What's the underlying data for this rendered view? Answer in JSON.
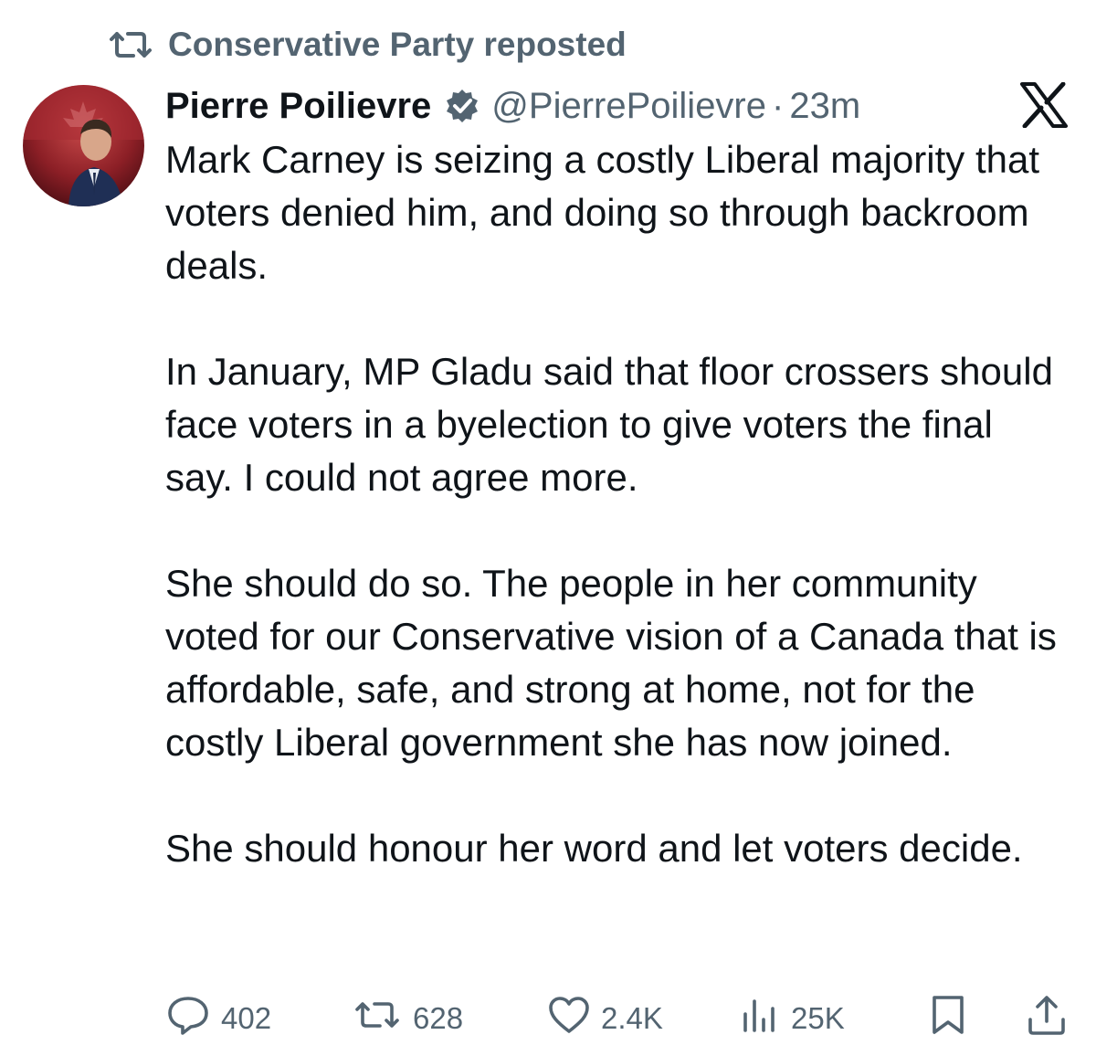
{
  "repost": {
    "icon": "repost-icon",
    "label": "Conservative Party reposted"
  },
  "author": {
    "name": "Pierre Poilievre",
    "verified_icon": "verified-badge-icon",
    "handle": "@PierrePoilievre",
    "separator": "·",
    "time": "23m",
    "avatar": "avatar-photo"
  },
  "brand": {
    "logo": "x-logo-icon"
  },
  "tweet": {
    "paragraphs": [
      "Mark Carney is seizing a costly Liberal majority that voters denied him, and doing so through backroom deals.",
      "In January, MP Gladu said that floor crossers should face voters in a byelection to give voters the final say. I could not agree more.",
      "She should do so. The people in her community voted for our Conservative vision of a Canada that is affordable, safe, and strong at home, not for the costly Liberal government she has now joined.",
      "She should honour her word and let voters decide."
    ]
  },
  "actions": {
    "replies": {
      "icon": "reply-icon",
      "count": "402"
    },
    "reposts": {
      "icon": "repost-icon",
      "count": "628"
    },
    "likes": {
      "icon": "heart-icon",
      "count": "2.4K"
    },
    "views": {
      "icon": "views-icon",
      "count": "25K"
    },
    "bookmark": {
      "icon": "bookmark-icon"
    },
    "share": {
      "icon": "share-icon"
    }
  },
  "colors": {
    "text_primary": "#0f1419",
    "text_secondary": "#536471",
    "verified_badge": "#536471",
    "background": "#ffffff"
  }
}
